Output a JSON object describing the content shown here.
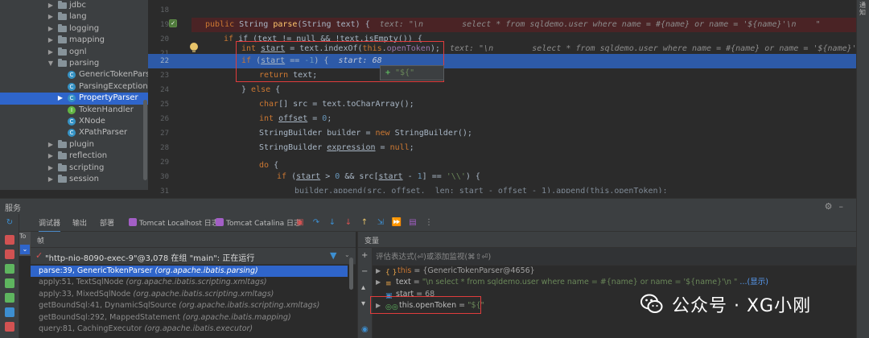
{
  "project_tree": {
    "items": [
      {
        "label": "jdbc",
        "kind": "folder",
        "expanded": false
      },
      {
        "label": "lang",
        "kind": "folder",
        "expanded": false
      },
      {
        "label": "logging",
        "kind": "folder",
        "expanded": false
      },
      {
        "label": "mapping",
        "kind": "folder",
        "expanded": false
      },
      {
        "label": "ognl",
        "kind": "folder",
        "expanded": false
      },
      {
        "label": "parsing",
        "kind": "folder",
        "expanded": true
      },
      {
        "label": "GenericTokenParser",
        "kind": "class"
      },
      {
        "label": "ParsingException",
        "kind": "class"
      },
      {
        "label": "PropertyParser",
        "kind": "class",
        "selected": true
      },
      {
        "label": "TokenHandler",
        "kind": "class"
      },
      {
        "label": "XNode",
        "kind": "class"
      },
      {
        "label": "XPathParser",
        "kind": "class"
      },
      {
        "label": "plugin",
        "kind": "folder",
        "expanded": false
      },
      {
        "label": "reflection",
        "kind": "folder",
        "expanded": false
      },
      {
        "label": "scripting",
        "kind": "folder",
        "expanded": false
      },
      {
        "label": "session",
        "kind": "folder",
        "expanded": false
      }
    ]
  },
  "editor": {
    "lines": [
      {
        "num": "18",
        "state": ""
      },
      {
        "num": "19",
        "state": "error"
      },
      {
        "num": "20",
        "state": ""
      },
      {
        "num": "21",
        "state": ""
      },
      {
        "num": "22",
        "state": "exec"
      },
      {
        "num": "23",
        "state": ""
      },
      {
        "num": "24",
        "state": ""
      },
      {
        "num": "25",
        "state": ""
      },
      {
        "num": "26",
        "state": ""
      },
      {
        "num": "27",
        "state": ""
      },
      {
        "num": "28",
        "state": ""
      },
      {
        "num": "29",
        "state": ""
      },
      {
        "num": "30",
        "state": ""
      },
      {
        "num": "31",
        "state": ""
      },
      {
        "num": "32",
        "state": ""
      }
    ],
    "code": {
      "l19_kw": "public ",
      "l19_type": "String ",
      "l19_fn": "parse",
      "l19_params": "(String text) {  ",
      "l19_hint": "text: \"\\n        select * from sqldemo.user where name = #{name} or name = '${name}'\\n    \"",
      "l20": "if (text != null && !text.isEmpty()) {",
      "l21_kw": "int ",
      "l21_var": "start",
      "l21_mid": " = text.indexOf(",
      "l21_this": "this",
      "l21_dot": ".",
      "l21_field": "openToken",
      "l21_end": ");  ",
      "l21_hint": "text: \"\\n        select * from sqldemo.user where name = #{name} or name = '${name}'\\n    \"",
      "l22_kw": "if ",
      "l22_open": "(",
      "l22_var": "start",
      "l22_op": " == ",
      "l22_num": "-1",
      "l22_end": ") {  ",
      "l22_hint": "start: 68",
      "l23_kw": "return ",
      "l23_rest": "text;",
      "l24_close": "} ",
      "l24_kw": "else ",
      "l24_open": "{",
      "l25_kw": "char",
      "l25_rest": "[] src = text.toCharArray();",
      "l26_kw": "int ",
      "l26_var": "offset",
      "l26_eq": " = ",
      "l26_num": "0",
      "l26_end": ";",
      "l27_a": "StringBuilder builder = ",
      "l27_kw": "new ",
      "l27_b": "StringBuilder();",
      "l28_a": "StringBuilder ",
      "l28_var": "expression",
      "l28_eq": " = ",
      "l28_kw": "null",
      "l28_end": ";",
      "l30_kw": "do ",
      "l30_open": "{",
      "l31_kw": "if ",
      "l31_a": "(",
      "l31_v1": "start",
      "l31_gt": " > ",
      "l31_n0": "0",
      "l31_b": " && src[",
      "l31_v2": "start",
      "l31_c": " - ",
      "l31_n1": "1",
      "l31_d": "] == ",
      "l31_s": "'\\\\'",
      "l31_e": ") {",
      "l32_text": "builder.append(src, offset,  len: start - offset - 1).append(this.openToken);"
    },
    "popup": {
      "plus": "+",
      "value": "\"${\""
    }
  },
  "right_stripe": {
    "label": "通知"
  },
  "services": {
    "title": "服务"
  },
  "debug_tabs": {
    "debugger": "调试器",
    "console": "输出",
    "deploy": "部署",
    "tomcat_localhost": "Tomcat Localhost 日志",
    "tomcat_catalina": "Tomcat Catalina 日志"
  },
  "left_tab": {
    "label": "To"
  },
  "frames": {
    "title": "帧",
    "thread": "\"http-nio-8090-exec-9\"@3,078 在组 \"main\": 正在运行",
    "list": [
      {
        "method": "parse:39, GenericTokenParser ",
        "pkg": "(org.apache.ibatis.parsing)",
        "active": true
      },
      {
        "method": "apply:51, TextSqlNode ",
        "pkg": "(org.apache.ibatis.scripting.xmltags)"
      },
      {
        "method": "apply:33, MixedSqlNode ",
        "pkg": "(org.apache.ibatis.scripting.xmltags)"
      },
      {
        "method": "getBoundSql:41, DynamicSqlSource ",
        "pkg": "(org.apache.ibatis.scripting.xmltags)"
      },
      {
        "method": "getBoundSql:292, MappedStatement ",
        "pkg": "(org.apache.ibatis.mapping)"
      },
      {
        "method": "query:81, CachingExecutor ",
        "pkg": "(org.apache.ibatis.executor)"
      }
    ]
  },
  "variables": {
    "title": "变量",
    "eval_placeholder": "评估表达式(⏎)或添加监视(⌘⇧⏎)",
    "rows": [
      {
        "name": "this",
        "eq": " = ",
        "value": "{GenericTokenParser@4656}",
        "link": ""
      },
      {
        "name": "text",
        "eq": " = ",
        "value": "\"\\n        select * from sqldemo.user where name = #{name} or name = '${name}'\\n    \"",
        "link": " ...(显示)"
      },
      {
        "name": "start",
        "eq": " = ",
        "value": "68",
        "link": ""
      },
      {
        "name": "this.openToken",
        "eq": " = ",
        "value": "\"${\"",
        "link": ""
      }
    ]
  },
  "watermark": {
    "text": "公众号 · XG小刚"
  },
  "colors": {
    "accent": "#2f65ca",
    "highlight_box": "#e03c3c",
    "error_line": "#4a2325"
  }
}
